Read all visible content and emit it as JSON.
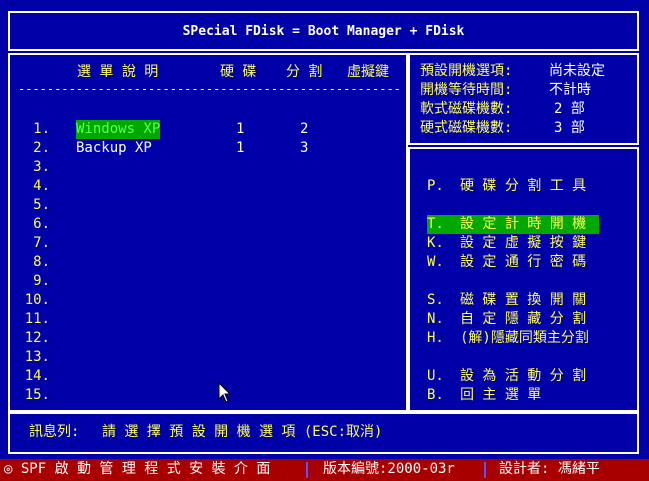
{
  "header": {
    "title": "SPecial FDisk = Boot Manager + FDisk"
  },
  "table": {
    "headers": {
      "desc": "選 單 說 明",
      "disk": "硬 碟",
      "part": "分 割",
      "hotkey": "虛擬鍵"
    },
    "separator": "-------------------------------------------------------------",
    "rows": [
      {
        "num": "1.",
        "desc": "Windows XP",
        "disk": "1",
        "part": "2"
      },
      {
        "num": "2.",
        "desc": "Backup XP",
        "disk": "1",
        "part": "3"
      },
      {
        "num": "3.",
        "desc": "",
        "disk": "",
        "part": ""
      },
      {
        "num": "4.",
        "desc": "",
        "disk": "",
        "part": ""
      },
      {
        "num": "5.",
        "desc": "",
        "disk": "",
        "part": ""
      },
      {
        "num": "6.",
        "desc": "",
        "disk": "",
        "part": ""
      },
      {
        "num": "7.",
        "desc": "",
        "disk": "",
        "part": ""
      },
      {
        "num": "8.",
        "desc": "",
        "disk": "",
        "part": ""
      },
      {
        "num": "9.",
        "desc": "",
        "disk": "",
        "part": ""
      },
      {
        "num": "10.",
        "desc": "",
        "disk": "",
        "part": ""
      },
      {
        "num": "11.",
        "desc": "",
        "disk": "",
        "part": ""
      },
      {
        "num": "12.",
        "desc": "",
        "disk": "",
        "part": ""
      },
      {
        "num": "13.",
        "desc": "",
        "disk": "",
        "part": ""
      },
      {
        "num": "14.",
        "desc": "",
        "disk": "",
        "part": ""
      },
      {
        "num": "15.",
        "desc": "",
        "disk": "",
        "part": ""
      }
    ]
  },
  "info": {
    "default_label": "預設開機選項:",
    "default_value": "尚未設定",
    "wait_label": "開機等待時間:",
    "wait_value": "不計時",
    "soft_label": "軟式磁碟機數:",
    "soft_value": "2 部",
    "hard_label": "硬式磁碟機數:",
    "hard_value": "3 部"
  },
  "menu": {
    "p": {
      "key": "P.",
      "label": "硬 碟 分 割 工 具"
    },
    "t": {
      "key": "T.",
      "label": "設 定 計 時 開 機"
    },
    "k": {
      "key": "K.",
      "label": "設 定 虛 擬 按 鍵"
    },
    "w": {
      "key": "W.",
      "label": "設 定 通 行 密 碼"
    },
    "s": {
      "key": "S.",
      "label": "磁 碟 置 換 開 關"
    },
    "n": {
      "key": "N.",
      "label": "自 定 隱 藏 分 割"
    },
    "h": {
      "key": "H.",
      "label": "(解)隱藏同類主分割"
    },
    "u": {
      "key": "U.",
      "label": "設 為 活 動 分 割"
    },
    "b": {
      "key": "B.",
      "label": "回 主 選 單"
    }
  },
  "message": {
    "label": "訊息列:",
    "text": "請 選 擇 預 設 開 機 選 項 (ESC:取消)"
  },
  "status": {
    "left": "◎ SPF 啟 動 管 理 程 式 安 裝 介 面",
    "version": "版本編號:2000-03r",
    "author": "設計者: 馮緒平"
  },
  "colors": {
    "background": "#0000a8",
    "highlight": "#00a800",
    "status_bar": "#a80000",
    "accent_yellow": "#ffff55",
    "accent_green": "#55ff55"
  }
}
